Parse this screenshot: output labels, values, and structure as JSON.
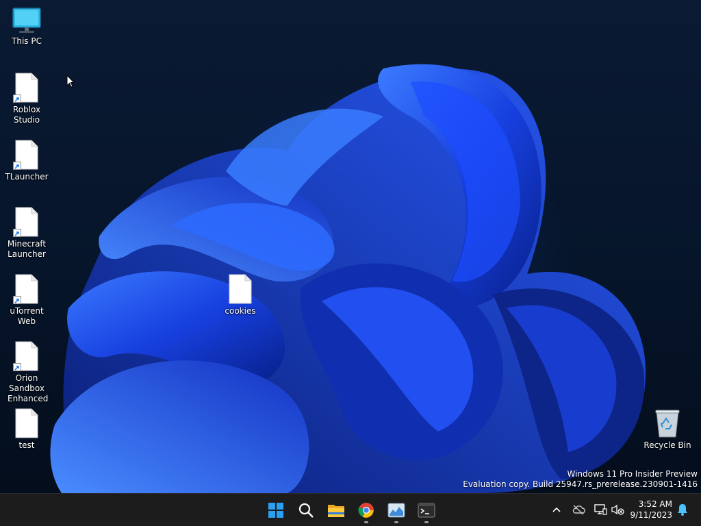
{
  "desktop": {
    "icons": [
      {
        "id": "this-pc",
        "label": "This PC",
        "type": "monitor-icon"
      },
      {
        "id": "roblox-studio",
        "label": "Roblox Studio",
        "type": "shortcut-file-icon"
      },
      {
        "id": "tlauncher",
        "label": "TLauncher",
        "type": "shortcut-file-icon"
      },
      {
        "id": "minecraft-launcher",
        "label": "Minecraft Launcher",
        "type": "shortcut-file-icon"
      },
      {
        "id": "utorrent-web",
        "label": "uTorrent Web",
        "type": "shortcut-file-icon"
      },
      {
        "id": "orion-sandbox",
        "label": "Orion Sandbox Enhanced",
        "type": "shortcut-file-icon"
      },
      {
        "id": "test",
        "label": "test",
        "type": "file-icon"
      },
      {
        "id": "cookies",
        "label": "cookies",
        "type": "file-icon"
      },
      {
        "id": "recycle-bin",
        "label": "Recycle Bin",
        "type": "recycle-bin-icon"
      }
    ],
    "watermark": {
      "line1": "Windows 11 Pro Insider Preview",
      "line2": "Evaluation copy. Build 25947.rs_prerelease.230901-1416"
    }
  },
  "taskbar": {
    "apps": [
      {
        "name": "start",
        "icon": "windows-logo-icon",
        "running": false
      },
      {
        "name": "search",
        "icon": "search-icon",
        "running": false
      },
      {
        "name": "file-explorer",
        "icon": "folder-icon",
        "running": false
      },
      {
        "name": "chrome",
        "icon": "chrome-icon",
        "running": true
      },
      {
        "name": "task-manager",
        "icon": "task-manager-icon",
        "running": true
      },
      {
        "name": "terminal",
        "icon": "terminal-icon",
        "running": true
      }
    ],
    "tray": {
      "icons": [
        "chevron-up-icon",
        "onedrive-offline-icon",
        "network-icon",
        "volume-muted-icon",
        "notification-bell-icon"
      ],
      "time": "3:52 AM",
      "date": "9/11/2023"
    }
  },
  "colors": {
    "taskbar": "#1c1c1c",
    "bloom": "#1a4fff",
    "accent": "#0078d4"
  }
}
